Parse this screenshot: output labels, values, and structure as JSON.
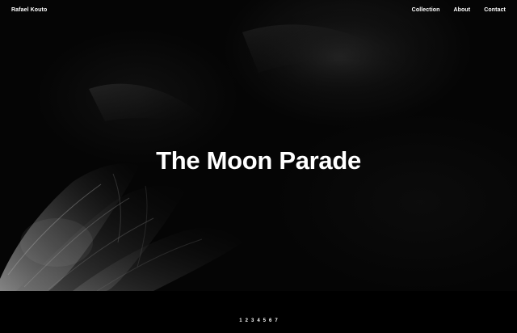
{
  "header": {
    "brand": "Rafael Kouto",
    "nav": [
      {
        "label": "Collection"
      },
      {
        "label": "About"
      },
      {
        "label": "Contact"
      }
    ]
  },
  "hero": {
    "title": "The Moon Parade"
  },
  "pagination": {
    "pages": [
      "1",
      "2",
      "3",
      "4",
      "5",
      "6",
      "7"
    ],
    "current": "1"
  },
  "colors": {
    "background": "#000000",
    "text": "#ffffff"
  }
}
